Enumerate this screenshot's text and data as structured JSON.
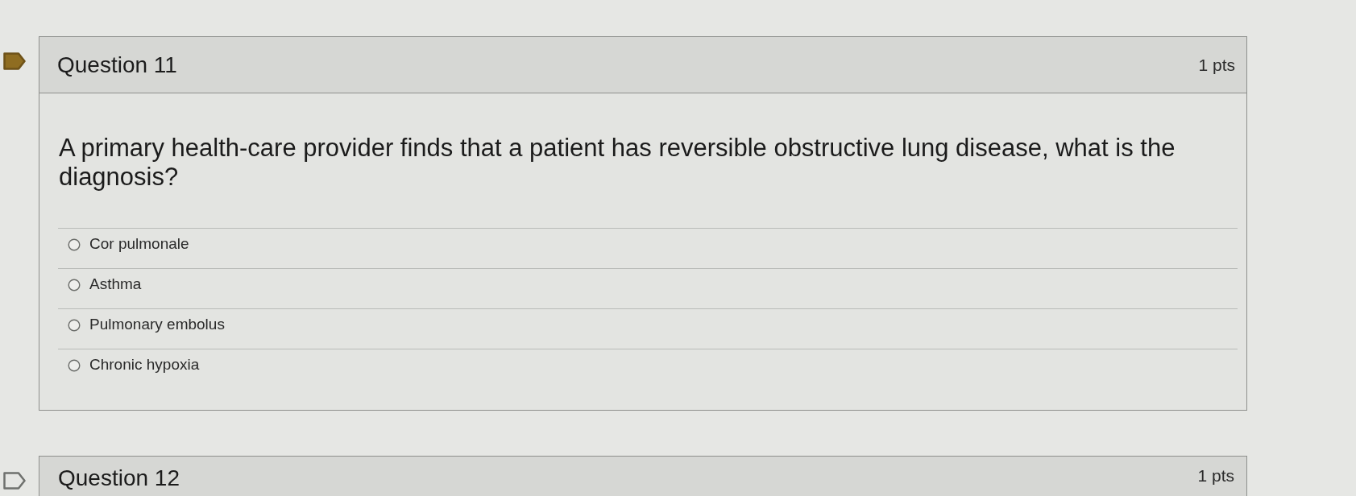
{
  "questions": [
    {
      "title": "Question 11",
      "points": "1 pts",
      "flagged": true,
      "prompt": "A primary health-care provider finds that a patient has reversible obstructive lung disease, what is the diagnosis?",
      "answers": [
        {
          "label": "Cor pulmonale",
          "selected": false
        },
        {
          "label": "Asthma",
          "selected": false
        },
        {
          "label": "Pulmonary embolus",
          "selected": false
        },
        {
          "label": "Chronic hypoxia",
          "selected": false
        }
      ]
    },
    {
      "title": "Question 12",
      "points": "1 pts",
      "flagged": false
    }
  ]
}
